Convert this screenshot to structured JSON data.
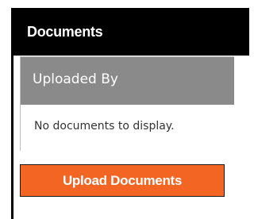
{
  "panel": {
    "title": "Documents"
  },
  "table": {
    "column_header": "Uploaded By",
    "empty_message": "No documents to display."
  },
  "actions": {
    "upload_label": "Upload Documents"
  },
  "colors": {
    "header_background": "#000000",
    "table_header_background": "#8a8a8a",
    "button_background": "#f26522"
  }
}
